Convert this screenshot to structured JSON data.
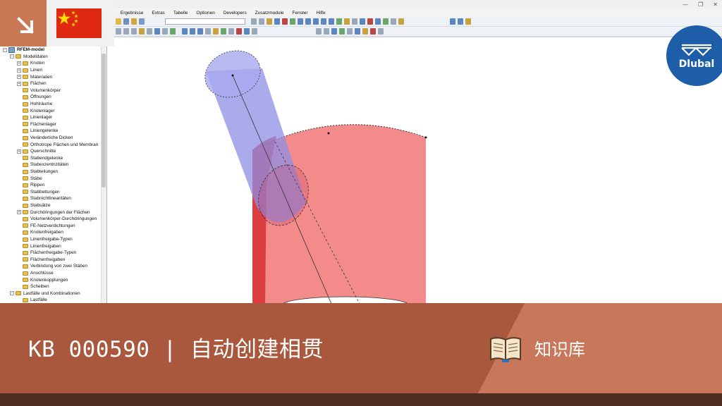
{
  "window": {
    "minimize_glyph": "—",
    "maximize_glyph": "❐",
    "close_glyph": "✕"
  },
  "menu": [
    {
      "label": "ung"
    },
    {
      "label": "Ergebnisse"
    },
    {
      "label": "Extras"
    },
    {
      "label": "Tabelle"
    },
    {
      "label": "Optionen"
    },
    {
      "label": "Developers"
    },
    {
      "label": "Zusatzmodule"
    },
    {
      "label": "Fenster"
    },
    {
      "label": "Hilfe"
    }
  ],
  "navigator": {
    "items": [
      {
        "label": "RFEM-model",
        "level": 0,
        "expander": "−",
        "root": true
      },
      {
        "label": "Modelldaten",
        "level": 1,
        "expander": "−"
      },
      {
        "label": "Knoten",
        "level": 2,
        "expander": "+"
      },
      {
        "label": "Linien",
        "level": 2,
        "expander": "+"
      },
      {
        "label": "Materialien",
        "level": 2,
        "expander": "+"
      },
      {
        "label": "Flächen",
        "level": 2,
        "expander": "+"
      },
      {
        "label": "Volumenkörper",
        "level": 2,
        "expander": ""
      },
      {
        "label": "Öffnungen",
        "level": 2,
        "expander": ""
      },
      {
        "label": "Hohlräume",
        "level": 2,
        "expander": ""
      },
      {
        "label": "Knotenlager",
        "level": 2,
        "expander": ""
      },
      {
        "label": "Linienlager",
        "level": 2,
        "expander": ""
      },
      {
        "label": "Flächenlager",
        "level": 2,
        "expander": ""
      },
      {
        "label": "Liniengelenke",
        "level": 2,
        "expander": ""
      },
      {
        "label": "Veränderliche Dicken",
        "level": 2,
        "expander": ""
      },
      {
        "label": "Orthotrope Flächen und Membran",
        "level": 2,
        "expander": ""
      },
      {
        "label": "Querschnitte",
        "level": 2,
        "expander": "+"
      },
      {
        "label": "Stabendgelenke",
        "level": 2,
        "expander": ""
      },
      {
        "label": "Stabexzentrizitäten",
        "level": 2,
        "expander": ""
      },
      {
        "label": "Stabteilungen",
        "level": 2,
        "expander": ""
      },
      {
        "label": "Stäbe",
        "level": 2,
        "expander": ""
      },
      {
        "label": "Rippen",
        "level": 2,
        "expander": ""
      },
      {
        "label": "Stabbettungen",
        "level": 2,
        "expander": ""
      },
      {
        "label": "Stabnichtlinearitäten",
        "level": 2,
        "expander": ""
      },
      {
        "label": "Stabsätze",
        "level": 2,
        "expander": ""
      },
      {
        "label": "Durchdringungen der Flächen",
        "level": 2,
        "expander": "+"
      },
      {
        "label": "Volumenkörper-Durchdringungen",
        "level": 2,
        "expander": ""
      },
      {
        "label": "FE-Netzverdichtungen",
        "level": 2,
        "expander": ""
      },
      {
        "label": "Knotenfreigaben",
        "level": 2,
        "expander": ""
      },
      {
        "label": "Linienfreigabe-Typen",
        "level": 2,
        "expander": ""
      },
      {
        "label": "Linienfreigaben",
        "level": 2,
        "expander": ""
      },
      {
        "label": "Flächenfreigabe-Typen",
        "level": 2,
        "expander": ""
      },
      {
        "label": "Flächenfreigaben",
        "level": 2,
        "expander": ""
      },
      {
        "label": "Verbindung von zwei Stäben",
        "level": 2,
        "expander": ""
      },
      {
        "label": "Anschlüsse",
        "level": 2,
        "expander": ""
      },
      {
        "label": "Knotenkopplungen",
        "level": 2,
        "expander": ""
      },
      {
        "label": "Scheiben",
        "level": 2,
        "expander": ""
      },
      {
        "label": "Lastfälle und Kombinationen",
        "level": 1,
        "expander": "−"
      },
      {
        "label": "Lastfälle",
        "level": 2,
        "expander": ""
      }
    ]
  },
  "logo": {
    "text": "Dlubal"
  },
  "banner": {
    "title": "KB 000590 | 自动创建相贯",
    "section_label": "知识库"
  },
  "colors": {
    "banner_left": "#a9573d",
    "banner_right": "#c9775a",
    "footer": "#4f2d1f",
    "large_cylinder": "#f06a6a",
    "small_cylinder": "#8f8fe6",
    "dlubal_blue": "#1e5ea8",
    "flag_red": "#de2910",
    "flag_star": "#ffde00"
  }
}
